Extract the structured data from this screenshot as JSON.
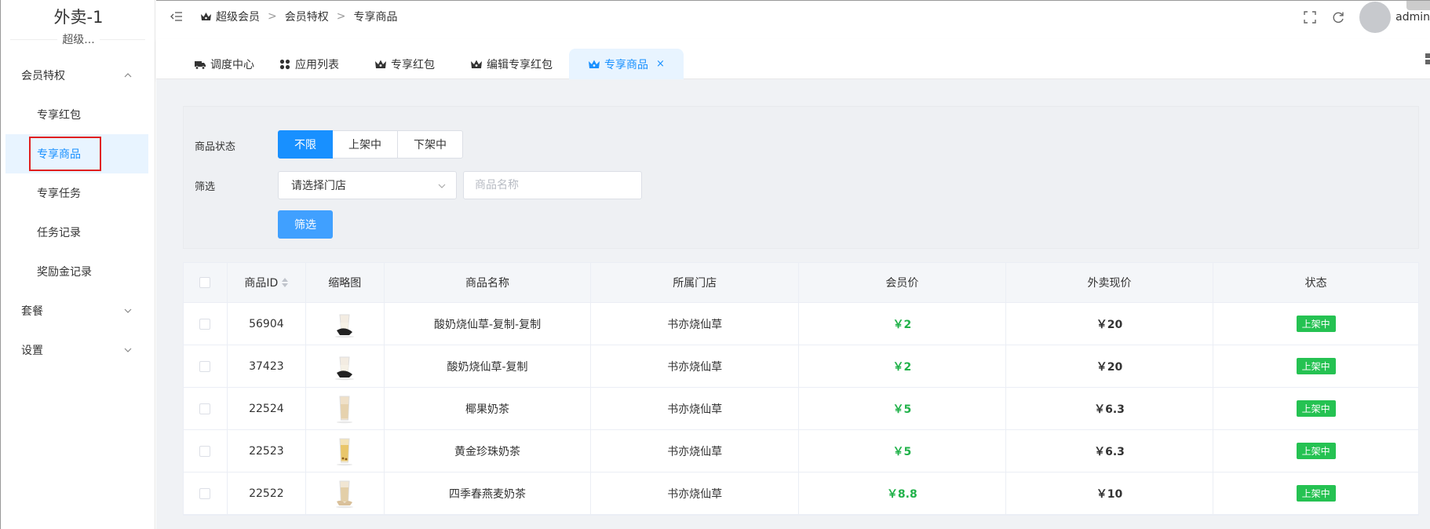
{
  "app": {
    "title": "外卖-1",
    "subtitle": "超级..."
  },
  "sidebar": {
    "groups": [
      {
        "label": "会员特权",
        "expanded": true
      },
      {
        "label": "套餐",
        "expanded": false
      },
      {
        "label": "设置",
        "expanded": false
      }
    ],
    "items": [
      {
        "label": "专享红包"
      },
      {
        "label": "专享商品",
        "active": true
      },
      {
        "label": "专享任务"
      },
      {
        "label": "任务记录"
      },
      {
        "label": "奖励金记录"
      }
    ]
  },
  "breadcrumb": {
    "items": [
      "超级会员",
      "会员特权",
      "专享商品"
    ],
    "separator": ">"
  },
  "header": {
    "user": "admin"
  },
  "tabs": [
    {
      "label": "调度中心",
      "icon": "truck-icon"
    },
    {
      "label": "应用列表",
      "icon": "apps-icon"
    },
    {
      "label": "专享红包",
      "icon": "crown-icon"
    },
    {
      "label": "编辑专享红包",
      "icon": "crown-icon"
    },
    {
      "label": "专享商品",
      "icon": "crown-icon",
      "active": true,
      "close": "×"
    }
  ],
  "filter": {
    "status_label": "商品状态",
    "status_options": [
      "不限",
      "上架中",
      "下架中"
    ],
    "status_selected": "不限",
    "filter_label": "筛选",
    "store_select": "请选择门店",
    "name_placeholder": "商品名称",
    "submit_label": "筛选"
  },
  "table": {
    "headers": [
      "商品ID",
      "缩略图",
      "商品名称",
      "所属门店",
      "会员价",
      "外卖现价",
      "状态"
    ],
    "rows": [
      {
        "id": "56904",
        "name": "酸奶烧仙草-复制-复制",
        "store": "书亦烧仙草",
        "member_price": "￥2",
        "price": "￥20",
        "status": "上架中",
        "thumb": "cup-dark"
      },
      {
        "id": "37423",
        "name": "酸奶烧仙草-复制",
        "store": "书亦烧仙草",
        "member_price": "￥2",
        "price": "￥20",
        "status": "上架中",
        "thumb": "cup-dark"
      },
      {
        "id": "22524",
        "name": "椰果奶茶",
        "store": "书亦烧仙草",
        "member_price": "￥5",
        "price": "￥6.3",
        "status": "上架中",
        "thumb": "cup-cream"
      },
      {
        "id": "22523",
        "name": "黄金珍珠奶茶",
        "store": "书亦烧仙草",
        "member_price": "￥5",
        "price": "￥6.3",
        "status": "上架中",
        "thumb": "cup-gold"
      },
      {
        "id": "22522",
        "name": "四季春燕麦奶茶",
        "store": "书亦烧仙草",
        "member_price": "￥8.8",
        "price": "￥10",
        "status": "上架中",
        "thumb": "cup-oat"
      }
    ]
  },
  "colors": {
    "primary": "#1890ff",
    "success": "#25c252",
    "price_green": "#21b24a"
  }
}
